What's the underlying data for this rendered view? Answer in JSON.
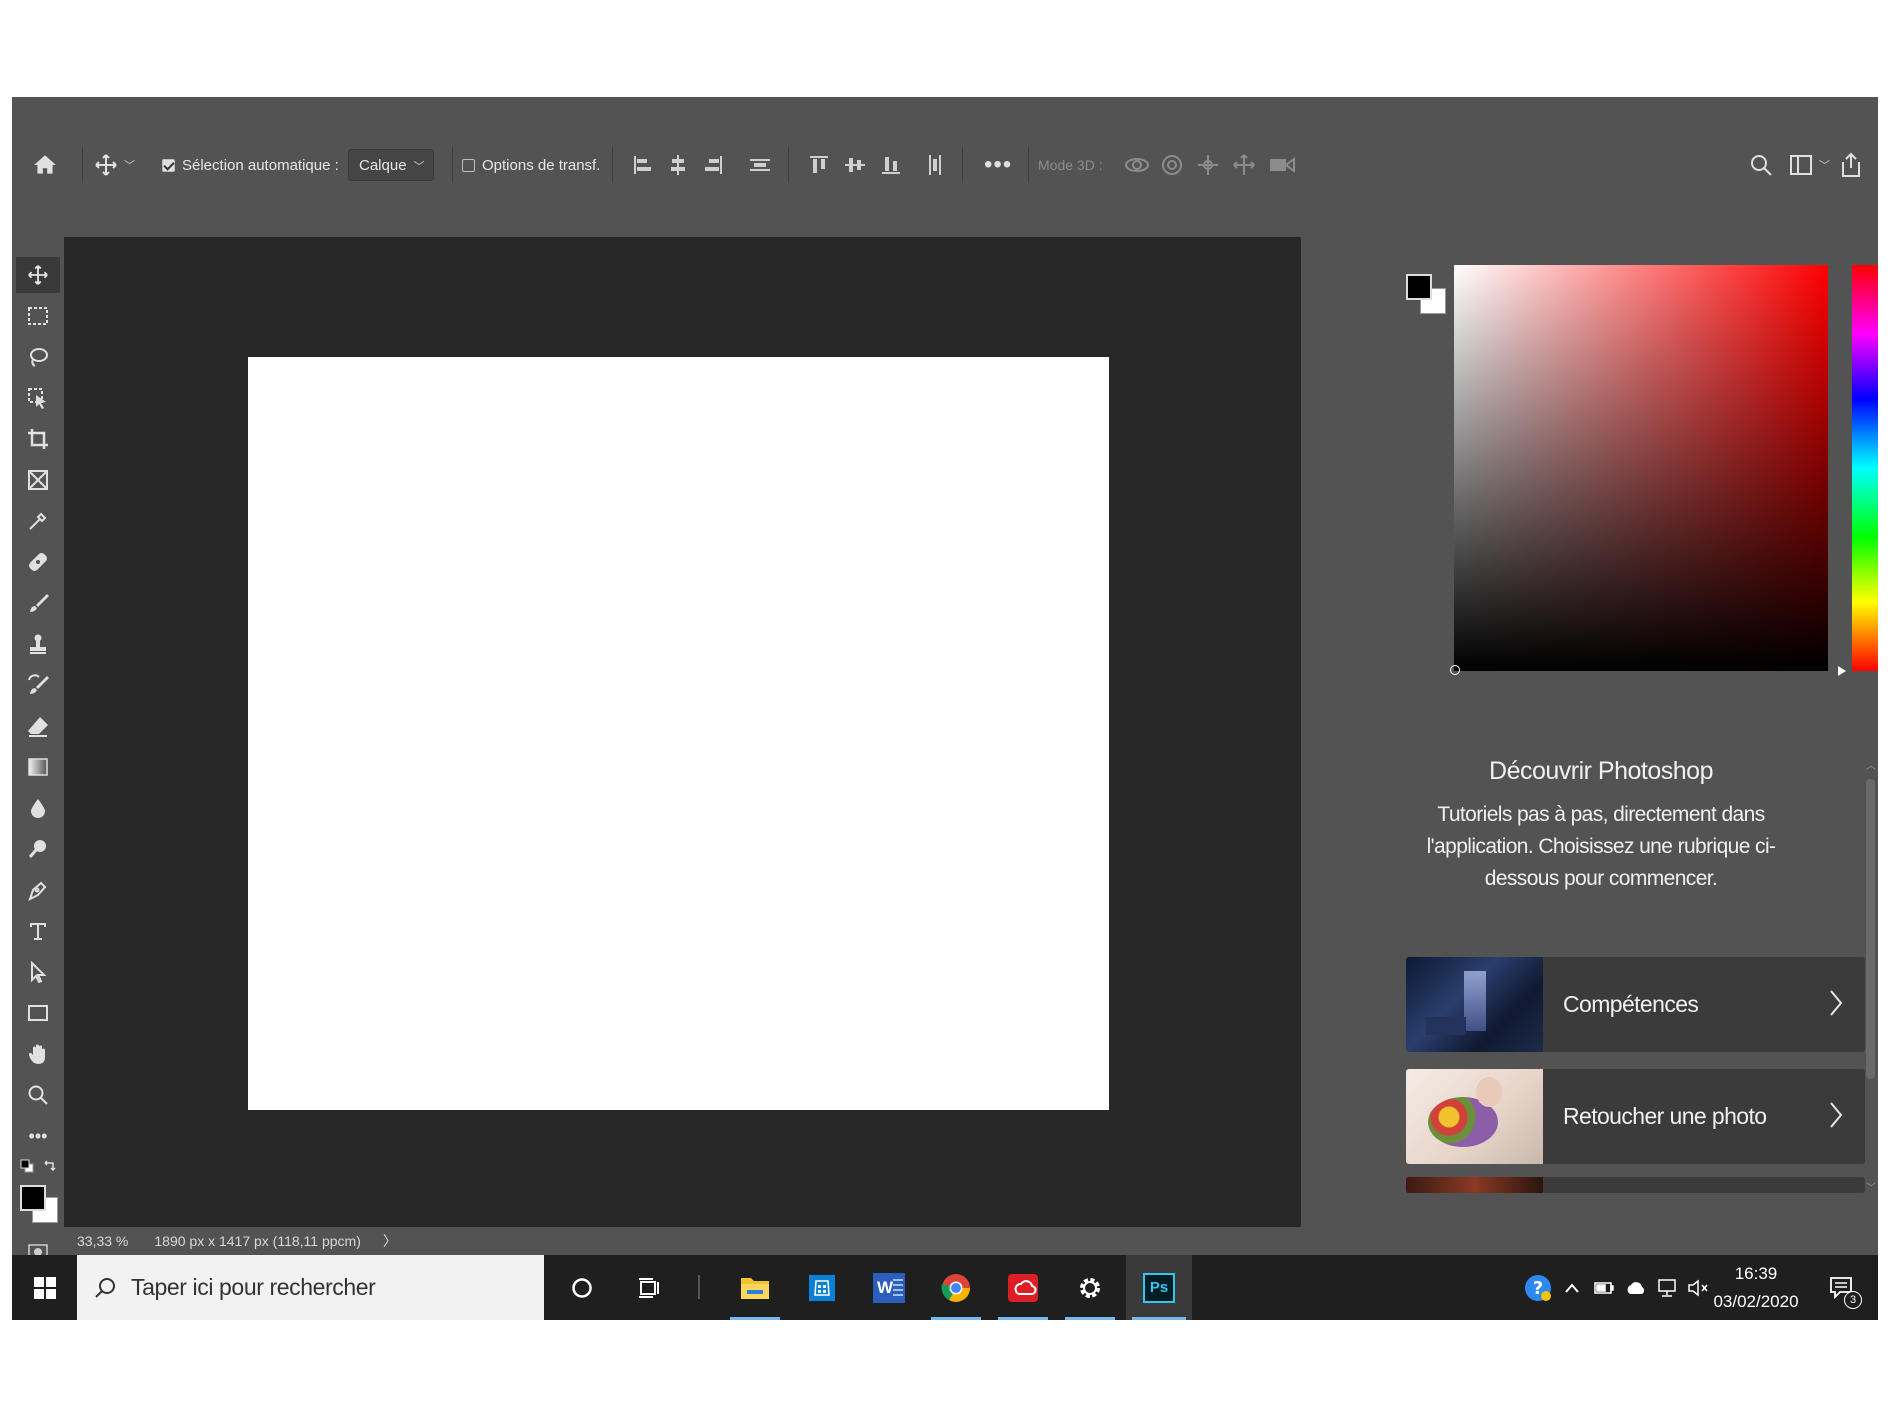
{
  "options_bar": {
    "auto_select_label": "Sélection automatique :",
    "auto_select_checked": true,
    "layer_select_value": "Calque",
    "transform_options_label": "Options de transf.",
    "transform_options_checked": false,
    "mode_3d_label": "Mode 3D :"
  },
  "status_bar": {
    "zoom": "33,33 %",
    "doc_info": "1890 px x 1417 px (118,11 ppcm)",
    "arrow": "〉"
  },
  "learn_panel": {
    "title": "Découvrir Photoshop",
    "description": "Tutoriels pas à pas, directement dans l'application. Choisissez une rubrique ci-dessous pour commencer.",
    "cards": [
      {
        "label": "Compétences",
        "thumb": "night-room-photo"
      },
      {
        "label": "Retoucher une photo",
        "thumb": "flower-bouquet-photo"
      }
    ]
  },
  "colors": {
    "workspace_bg": "#535353",
    "canvas_bg": "#282828",
    "document": "#ffffff",
    "foreground_color": "#000000",
    "background_color": "#ffffff",
    "picker_hue": "#ff0000"
  },
  "taskbar": {
    "search_placeholder": "Taper ici pour rechercher",
    "time": "16:39",
    "date": "03/02/2020",
    "notification_count": "3",
    "photoshop_icon_text": "Ps",
    "word_icon_text": "W"
  }
}
